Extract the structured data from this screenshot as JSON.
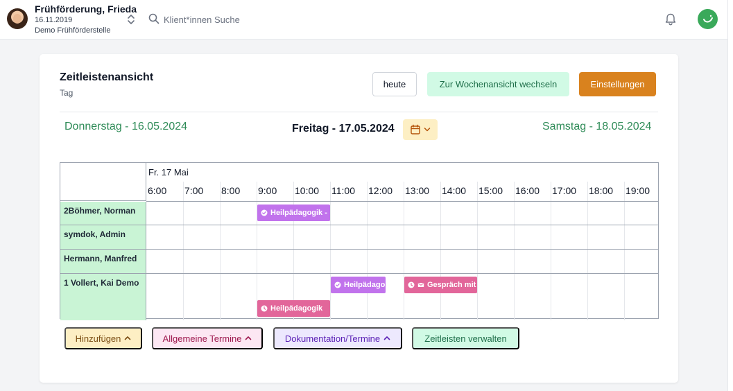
{
  "header": {
    "client_name": "Frühförderung, Frieda",
    "client_dob": "16.11.2019",
    "client_org": "Demo Frühförderstelle",
    "search_placeholder": "Klient*innen Suche"
  },
  "page": {
    "title": "Zeitleistenansicht",
    "subtitle": "Tag",
    "today_label": "heute",
    "week_view_label": "Zur Wochenansicht wechseln",
    "settings_label": "Einstellungen",
    "prev_day": "Donnerstag - 16.05.2024",
    "current_day": "Freitag - 17.05.2024",
    "next_day": "Samstag - 18.05.2024"
  },
  "timeline": {
    "date_header": "Fr. 17 Mai",
    "hours": [
      "6:00",
      "7:00",
      "8:00",
      "9:00",
      "10:00",
      "11:00",
      "12:00",
      "13:00",
      "14:00",
      "15:00",
      "16:00",
      "17:00",
      "18:00",
      "19:00"
    ],
    "rows": [
      {
        "name": "2Böhmer, Norman"
      },
      {
        "name": "symdok, Admin"
      },
      {
        "name": "Hermann, Manfred"
      },
      {
        "name": "1 Vollert, Kai Demo"
      }
    ],
    "events": [
      {
        "row": 0,
        "start_hour": "9:00",
        "end_hour": "11:00",
        "label": "Heilpädagogik -",
        "color": "#c173ec",
        "icons": [
          "check-circle-icon"
        ]
      },
      {
        "row": 3,
        "start_hour": "11:00",
        "end_hour": "12:30",
        "label": "Heilpädago",
        "color": "#c173ec",
        "icons": [
          "check-circle-icon"
        ]
      },
      {
        "row": 3,
        "start_hour": "13:00",
        "end_hour": "15:00",
        "label": "Gespräch mit",
        "color": "#e2669a",
        "icons": [
          "clock-icon",
          "envelope-icon"
        ]
      },
      {
        "row": 3,
        "start_hour": "9:00",
        "end_hour": "11:00",
        "label": "Heilpädagogik",
        "color": "#e2669a",
        "icons": [
          "clock-icon"
        ]
      }
    ]
  },
  "footer": {
    "add_label": "Hinzufügen",
    "general_label": "Allgemeine Termine",
    "docs_label": "Dokumentation/Termine",
    "manage_label": "Zeitleisten verwalten"
  },
  "colors": {
    "accent_green": "#2e8b57",
    "settings_orange": "#d9821e",
    "row_label_bg": "#c9f4d5",
    "event_purple": "#c173ec",
    "event_pink": "#e2669a"
  }
}
